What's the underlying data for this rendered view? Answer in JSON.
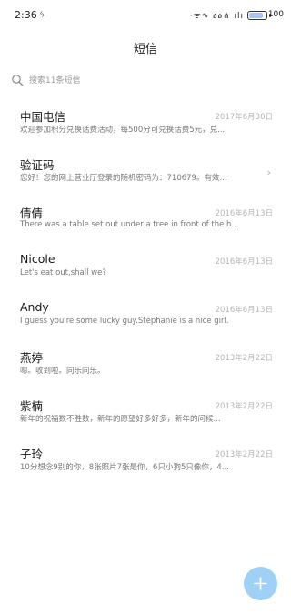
{
  "status_bar": {
    "time": "2:36",
    "time_icon": "ᛃ",
    "icons_text": "·ᯤ∿ ዕዕ⋔ ılı",
    "battery_level": 0.85,
    "battery_text": "100",
    "battery_color": "#a9c4f2"
  },
  "header": {
    "title": "短信"
  },
  "search": {
    "placeholder": "搜索11条短信",
    "icon": "search-icon"
  },
  "messages": [
    {
      "name": "中国电信",
      "date": "2017年6月30日",
      "preview": "欢迎参加积分兑换话费活动，每500分可兑换话费5元，兑..."
    },
    {
      "name": "验证码",
      "date": "",
      "preview": "您好！您的网上营业厅登录的随机密码为：710679。有效...",
      "has_chevron": true
    },
    {
      "name": "倩倩",
      "date": "2016年6月13日",
      "preview": "There was a table set out under a tree in front of the h..."
    },
    {
      "name": "Nicole",
      "date": "2016年6月13日",
      "preview": "Let's eat out,shall we?"
    },
    {
      "name": "Andy",
      "date": "2016年6月13日",
      "preview": "I guess you're some lucky guy.Stephanie is a nice girl."
    },
    {
      "name": "燕婷",
      "date": "2013年2月22日",
      "preview": "嗯。收到啦。同乐同乐。"
    },
    {
      "name": "紫楠",
      "date": "2013年2月22日",
      "preview": "新年的祝福数不胜数，新年的愿望好多好多，新年的问候..."
    },
    {
      "name": "子玲",
      "date": "2013年2月22日",
      "preview": "10分想念9别的你，8张照片7张是你，6只小狗5只像你，4..."
    }
  ],
  "fab": {
    "icon": "plus-icon",
    "color": "#9fd1f7"
  }
}
